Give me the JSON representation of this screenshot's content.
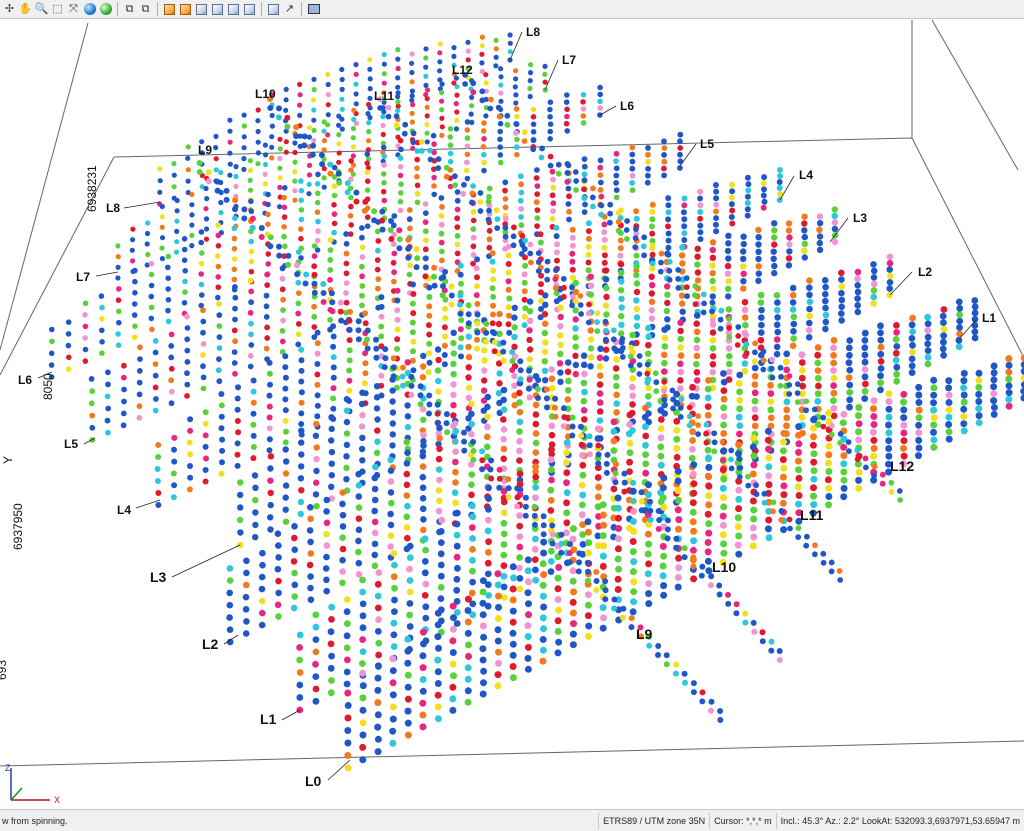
{
  "toolbar": {
    "buttons": [
      {
        "name": "pointer-tool-icon",
        "glyph": "✢"
      },
      {
        "name": "pan-hand-icon",
        "glyph": "✋"
      },
      {
        "name": "zoom-icon",
        "glyph": "🔍"
      },
      {
        "name": "select-box-icon",
        "glyph": "⬚"
      },
      {
        "name": "zoom-extents-icon",
        "glyph": "⤧"
      },
      {
        "name": "globe-icon",
        "glyph": ""
      },
      {
        "name": "globe-green-icon",
        "glyph": ""
      },
      {
        "name": "layers-icon",
        "glyph": "⧉"
      },
      {
        "name": "layers-add-icon",
        "glyph": "⧉"
      },
      {
        "name": "cube-view-1-icon",
        "glyph": ""
      },
      {
        "name": "cube-view-2-icon",
        "glyph": ""
      },
      {
        "name": "cube-view-3-icon",
        "glyph": ""
      },
      {
        "name": "cube-view-4-icon",
        "glyph": ""
      },
      {
        "name": "cube-view-5-icon",
        "glyph": ""
      },
      {
        "name": "cube-view-6-icon",
        "glyph": ""
      },
      {
        "name": "cube-view-7-icon",
        "glyph": ""
      },
      {
        "name": "export-icon",
        "glyph": "↗"
      },
      {
        "name": "screenshot-icon",
        "glyph": ""
      }
    ]
  },
  "viewport": {
    "axis_labels": {
      "y": "Y",
      "z": "Z",
      "x": "X"
    },
    "y_ticks": [
      "6938231",
      "8050",
      "6937950",
      "693"
    ],
    "line_labels_bottom": [
      "L0",
      "L1",
      "L2",
      "L3",
      "L4",
      "L5",
      "L6",
      "L7",
      "L8",
      "L9",
      "L10",
      "L11"
    ],
    "line_labels_right": [
      "L1",
      "L2",
      "L3",
      "L4",
      "L5",
      "L6",
      "L7",
      "L8",
      "L12"
    ],
    "cross_labels": [
      "L9",
      "L10",
      "L11",
      "L12"
    ]
  },
  "status": {
    "message": "w from spinning.",
    "crs": "ETRS89 / UTM zone 35N",
    "cursor": "Cursor: *,*,* m",
    "view": "Incl.: 45.3° Az.: 2.2° LookAt: 532093.3,6937971,53.65947 m"
  },
  "colors": {
    "blue": "#1f57c8",
    "cyan": "#2ec6dc",
    "green": "#58d23a",
    "yellow": "#f2e020",
    "orange": "#f27a1c",
    "red": "#e01a2e",
    "magenta": "#e8257f",
    "pink": "#f095d2"
  }
}
